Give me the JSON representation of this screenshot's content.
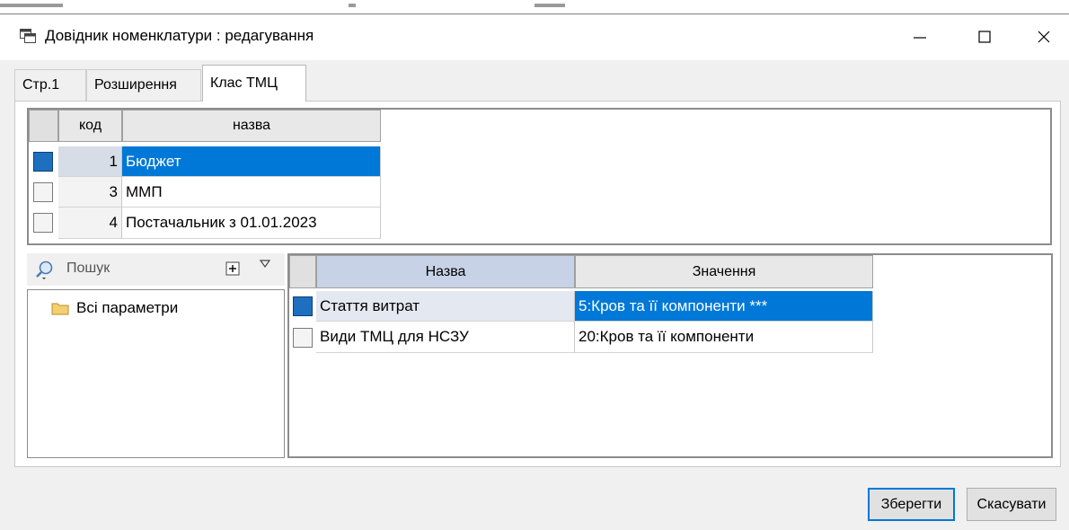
{
  "window": {
    "title": "Довідник номенклатури : редагування",
    "controls": {
      "minimize": "—",
      "maximize": "☐",
      "close": "✕"
    }
  },
  "tabs": [
    {
      "label": "Стр.1",
      "active": false
    },
    {
      "label": "Розширення",
      "active": false
    },
    {
      "label": "Клас ТМЦ",
      "active": true
    }
  ],
  "class_table": {
    "columns": {
      "code": "код",
      "name": "назва"
    },
    "rows": [
      {
        "code": "1",
        "name": "Бюджет",
        "selected": true
      },
      {
        "code": "3",
        "name": "ММП",
        "selected": false
      },
      {
        "code": "4",
        "name": "Постачальник з 01.01.2023",
        "selected": false
      }
    ]
  },
  "params": {
    "search_label": "Пошук",
    "tree_root": "Всі параметри"
  },
  "params_table": {
    "columns": {
      "name": "Назва",
      "value": "Значення"
    },
    "rows": [
      {
        "name": "Стаття витрат",
        "value": "5:Кров та її компоненти ***",
        "selected": true
      },
      {
        "name": "Види ТМЦ для НСЗУ",
        "value": "20:Кров та її компоненти",
        "selected": false
      }
    ]
  },
  "buttons": {
    "save": "Зберегти",
    "cancel": "Скасувати"
  },
  "colors": {
    "selection": "#0078d7",
    "indicator": "#1e6fc0",
    "folder": "#e8b84a"
  }
}
